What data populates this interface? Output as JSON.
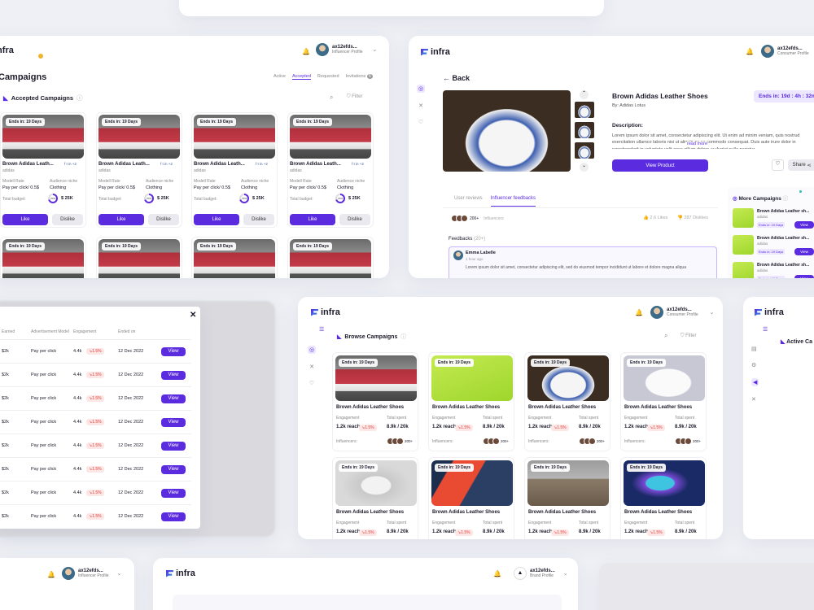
{
  "brand": "infra",
  "profiles": {
    "influencer": {
      "name": "ax12efds...",
      "role": "Influencer Profile"
    },
    "consumer": {
      "name": "ax12efds...",
      "role": "Consumer Profile"
    },
    "brand": {
      "name": "ax12efds...",
      "role": "Brand Profile"
    }
  },
  "campaigns_page": {
    "title": "Campaigns",
    "tabs": [
      "Active",
      "Accepted",
      "Requested",
      "Invitations"
    ],
    "invitations_count": "6",
    "section_title": "Accepted Campaigns",
    "filter": "Filter",
    "card": {
      "ends": "Ends in: 19 Days",
      "name": "Brown Adidas Leath...",
      "brand": "adidas",
      "model_label": "Modell Rate",
      "niche_label": "Audience niche",
      "model_value": "Pay per click/ 0.5$",
      "niche_value": "Clothing",
      "budget_label": "Total budget:",
      "pct": "70%",
      "budget": "$ 25K",
      "like": "Like",
      "dislike": "Dislike",
      "socials": "+2"
    }
  },
  "product": {
    "back": "Back",
    "title": "Brown Adidas Leather Shoes",
    "by": "By: Adidas Lotus",
    "ends": "Ends in: 19d : 4h : 32m",
    "desc_label": "Description:",
    "desc": "Lorem ipsum dolor sit amet, consectetur adipiscing elit. Ut enim ad minim veniam, quis nostrud exercitation ullamco laboris nisi ut aliquip ex ea commodo consequat. Duis aute irure dolor in reprehenderit in voluptate velit esse cillum dolore eu fugiat nulla pariatur.",
    "read_more": "read more",
    "view_product": "View Product",
    "share": "Share",
    "tabs": [
      "User reviews",
      "Influencer feedbacks"
    ],
    "influencers": "200+",
    "influencers_label": "Influencers",
    "likes": "2.6 Likes",
    "dislikes": "287 Dislikes",
    "feedbacks_label": "Feedbacks",
    "feedbacks_count": "(20+)",
    "fb_name": "Emma Labelle",
    "fb_time": "1 hour ago",
    "fb_text": "Lorem ipsum dolor sit amet, consectetur adipiscing elit, sed do eiusmod  tempor incididunt ut labore et dolore magna aliqua",
    "more_title": "More Campaigns",
    "more_items": [
      {
        "name": "Brown Adidas Leather sh...",
        "brand": "adidas",
        "ends": "Ends in: 19 Days",
        "view": "View"
      },
      {
        "name": "Brown Adidas Leather sh...",
        "brand": "adidas",
        "ends": "Ends in: 19 Days",
        "view": "View"
      },
      {
        "name": "Brown Adidas Leather sh...",
        "brand": "adidas",
        "ends": "Ends in: 19 Days",
        "view": "View"
      }
    ]
  },
  "table": {
    "headers": [
      "Earned",
      "Advertisement Model",
      "Engagement",
      "Ended on"
    ],
    "rows": [
      {
        "earned": "$2k",
        "model": "Pay per click",
        "eng": "4.4k",
        "delta": "↘1.5%",
        "date": "12 Dec 2022",
        "view": "View"
      },
      {
        "earned": "$2k",
        "model": "Pay per click",
        "eng": "4.4k",
        "delta": "↘1.5%",
        "date": "12 Dec 2022",
        "view": "View"
      },
      {
        "earned": "$2k",
        "model": "Pay per click",
        "eng": "4.4k",
        "delta": "↘1.5%",
        "date": "12 Dec 2022",
        "view": "View"
      },
      {
        "earned": "$2k",
        "model": "Pay per click",
        "eng": "4.4k",
        "delta": "↘1.5%",
        "date": "12 Dec 2022",
        "view": "View"
      },
      {
        "earned": "$2k",
        "model": "Pay per click",
        "eng": "4.4k",
        "delta": "↘1.5%",
        "date": "12 Dec 2022",
        "view": "View"
      },
      {
        "earned": "$2k",
        "model": "Pay per click",
        "eng": "4.4k",
        "delta": "↘1.5%",
        "date": "12 Dec 2022",
        "view": "View"
      },
      {
        "earned": "$2k",
        "model": "Pay per click",
        "eng": "4.4k",
        "delta": "↘1.5%",
        "date": "12 Dec 2022",
        "view": "View"
      },
      {
        "earned": "$2k",
        "model": "Pay per click",
        "eng": "4.4k",
        "delta": "↘1.5%",
        "date": "12 Dec 2022",
        "view": "View"
      }
    ]
  },
  "browse": {
    "title": "Browse Campaigns",
    "filter": "Filter",
    "cards": [
      {
        "img": "red",
        "ends": "Ends in: 19 Days",
        "name": "Brown Adidas Leather Shoes",
        "reach": "1.2k reach",
        "delta": "↘1.5%",
        "spent": "8.9k / 20k"
      },
      {
        "img": "lime",
        "ends": "Ends in: 19 Days",
        "name": "Brown Adidas Leather Shoes",
        "reach": "1.2k reach",
        "delta": "↘1.5%",
        "spent": "8.9k / 20k"
      },
      {
        "img": "whiteblue",
        "ends": "Ends in: 19 Days",
        "name": "Brown Adidas Leather Shoes",
        "reach": "1.2k reach",
        "delta": "↘1.5%",
        "spent": "8.9k / 20k"
      },
      {
        "img": "whitegrey",
        "ends": "Ends in: 19 Days",
        "name": "Brown Adidas Leather Shoes",
        "reach": "1.2k reach",
        "delta": "↘1.5%",
        "spent": "8.9k / 20k"
      },
      {
        "img": "greybg",
        "ends": "Ends in: 19 Days",
        "name": "Brown Adidas Leather Shoes",
        "reach": "1.2k reach",
        "delta": "↘1.5%",
        "spent": "8.9k / 20k"
      },
      {
        "img": "redblue",
        "ends": "Ends in: 19 Days",
        "name": "Brown Adidas Leather Shoes",
        "reach": "1.2k reach",
        "delta": "↘1.5%",
        "spent": "8.9k / 20k"
      },
      {
        "img": "greybox",
        "ends": "Ends in: 19 Days",
        "name": "Brown Adidas Leather Shoes",
        "reach": "1.2k reach",
        "delta": "↘1.5%",
        "spent": "8.9k / 20k"
      },
      {
        "img": "bluepop",
        "ends": "Ends in: 19 Days",
        "name": "Brown Adidas Leather Shoes",
        "reach": "1.2k reach",
        "delta": "↘1.5%",
        "spent": "8.9k / 20k"
      }
    ],
    "engagement_label": "Engagement",
    "spent_label": "Total spent",
    "influencers_label": "Influencers:",
    "influencers_count": "200+"
  },
  "right_panel": {
    "title": "Active Ca"
  }
}
